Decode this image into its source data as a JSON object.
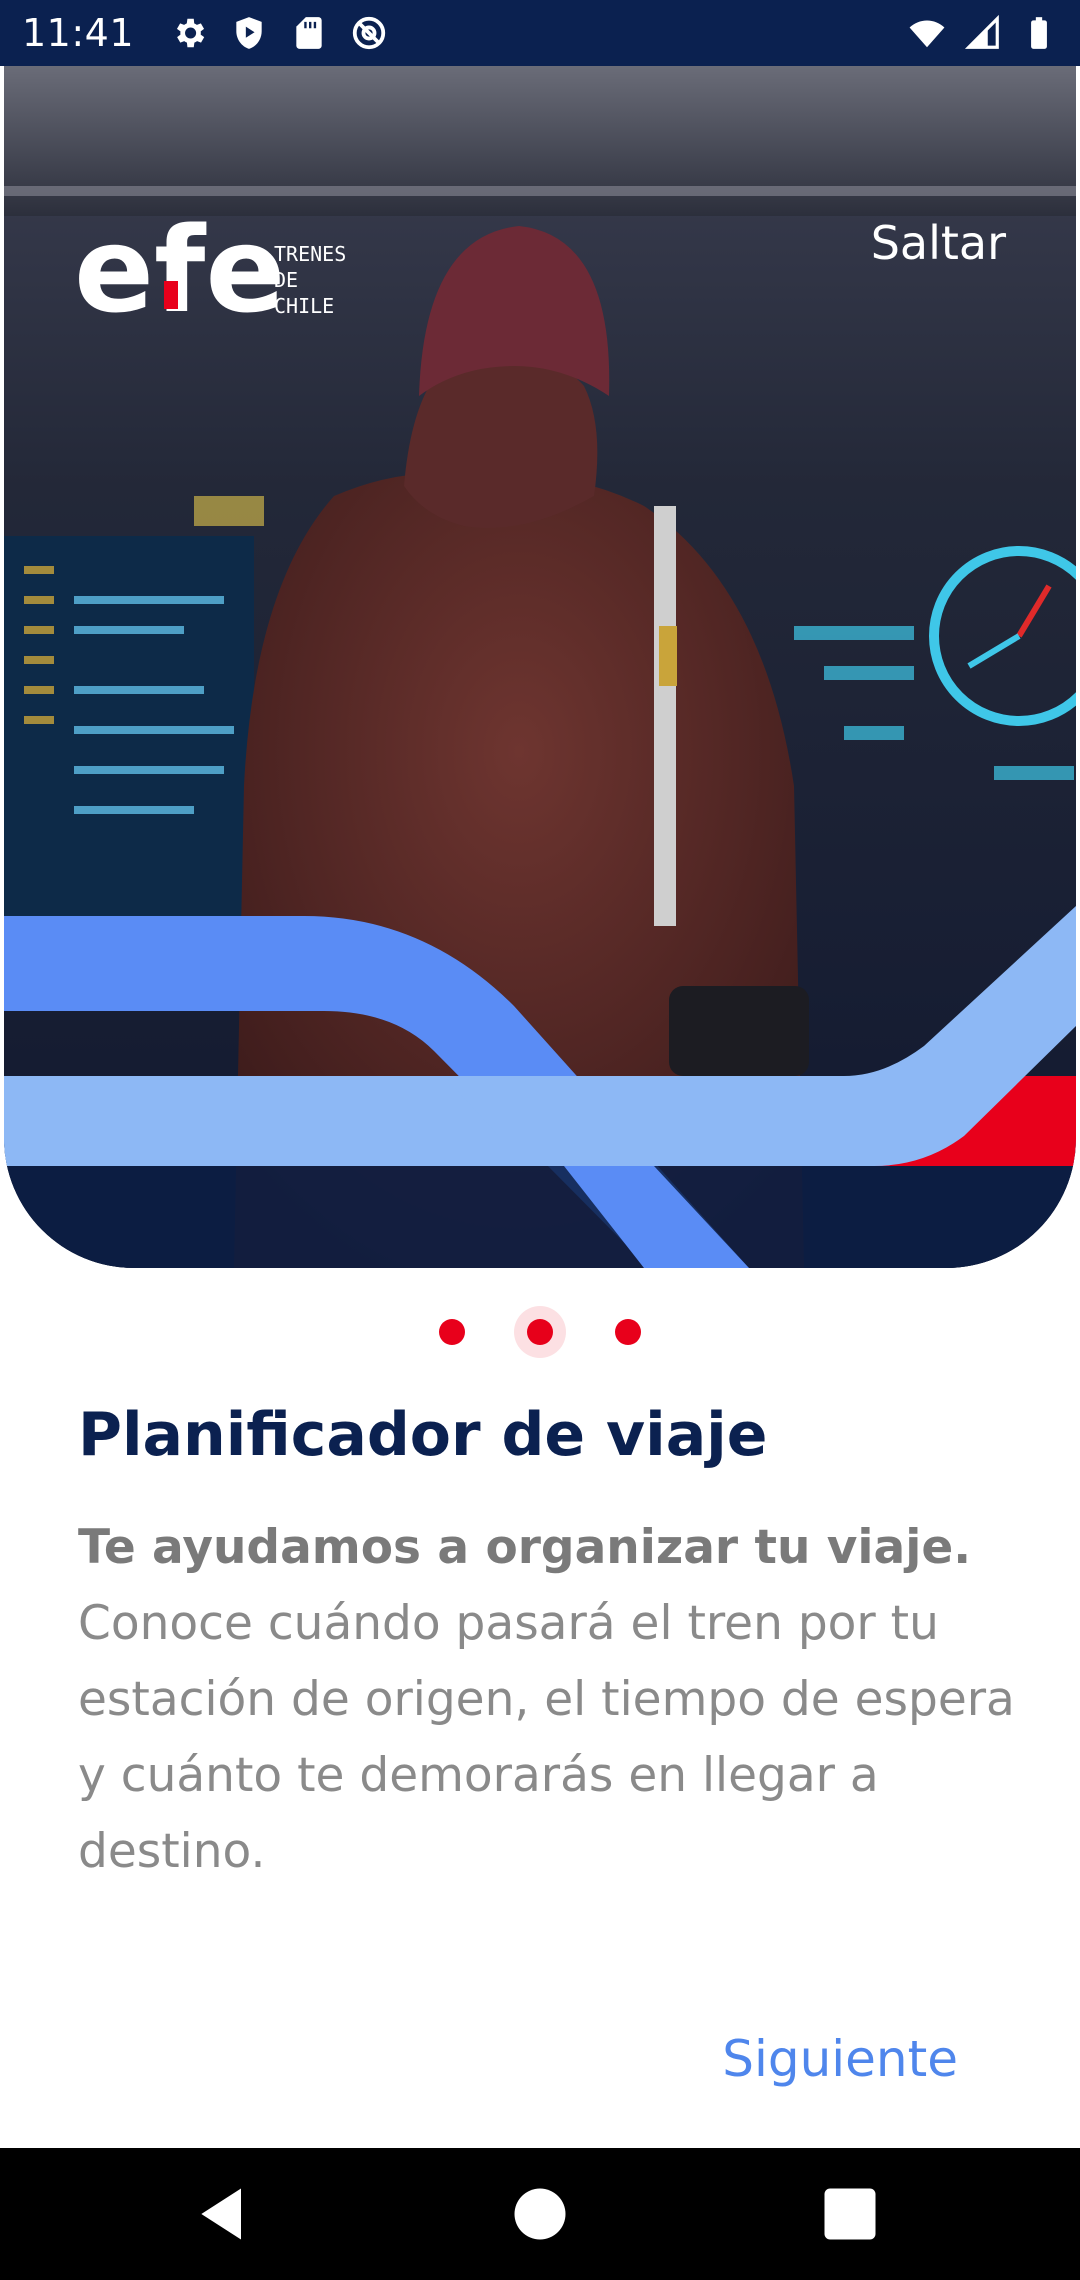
{
  "status_bar": {
    "time": "11:41",
    "left_icons": [
      "settings-icon",
      "shield-play-icon",
      "sd-card-icon",
      "at-sign-icon"
    ],
    "right_icons": [
      "wifi-icon",
      "signal-icon",
      "battery-icon"
    ]
  },
  "hero": {
    "logo": {
      "wordmark": "efe",
      "subtitle_lines": [
        "TRENES",
        "DE",
        "CHILE"
      ]
    },
    "skip_label": "Saltar"
  },
  "pager": {
    "count": 3,
    "active_index": 1
  },
  "content": {
    "title": "Planificador de viaje",
    "lead": "Te ayudamos a organizar tu viaje.",
    "body": "Conoce cuándo pasará el tren por tu estación de origen, el tiempo de espera y cuánto te demorarás en llegar a destino."
  },
  "footer": {
    "next_label": "Siguiente"
  },
  "colors": {
    "navy": "#0b2150",
    "brand_red": "#e8001b",
    "blue_stripe": "#5a8cf5",
    "light_blue_stripe": "#8db8f5",
    "link_blue": "#4f86ec",
    "body_gray": "#8a8a8a"
  },
  "nav_bar": {
    "icons": [
      "back-icon",
      "home-icon",
      "recents-icon"
    ]
  }
}
